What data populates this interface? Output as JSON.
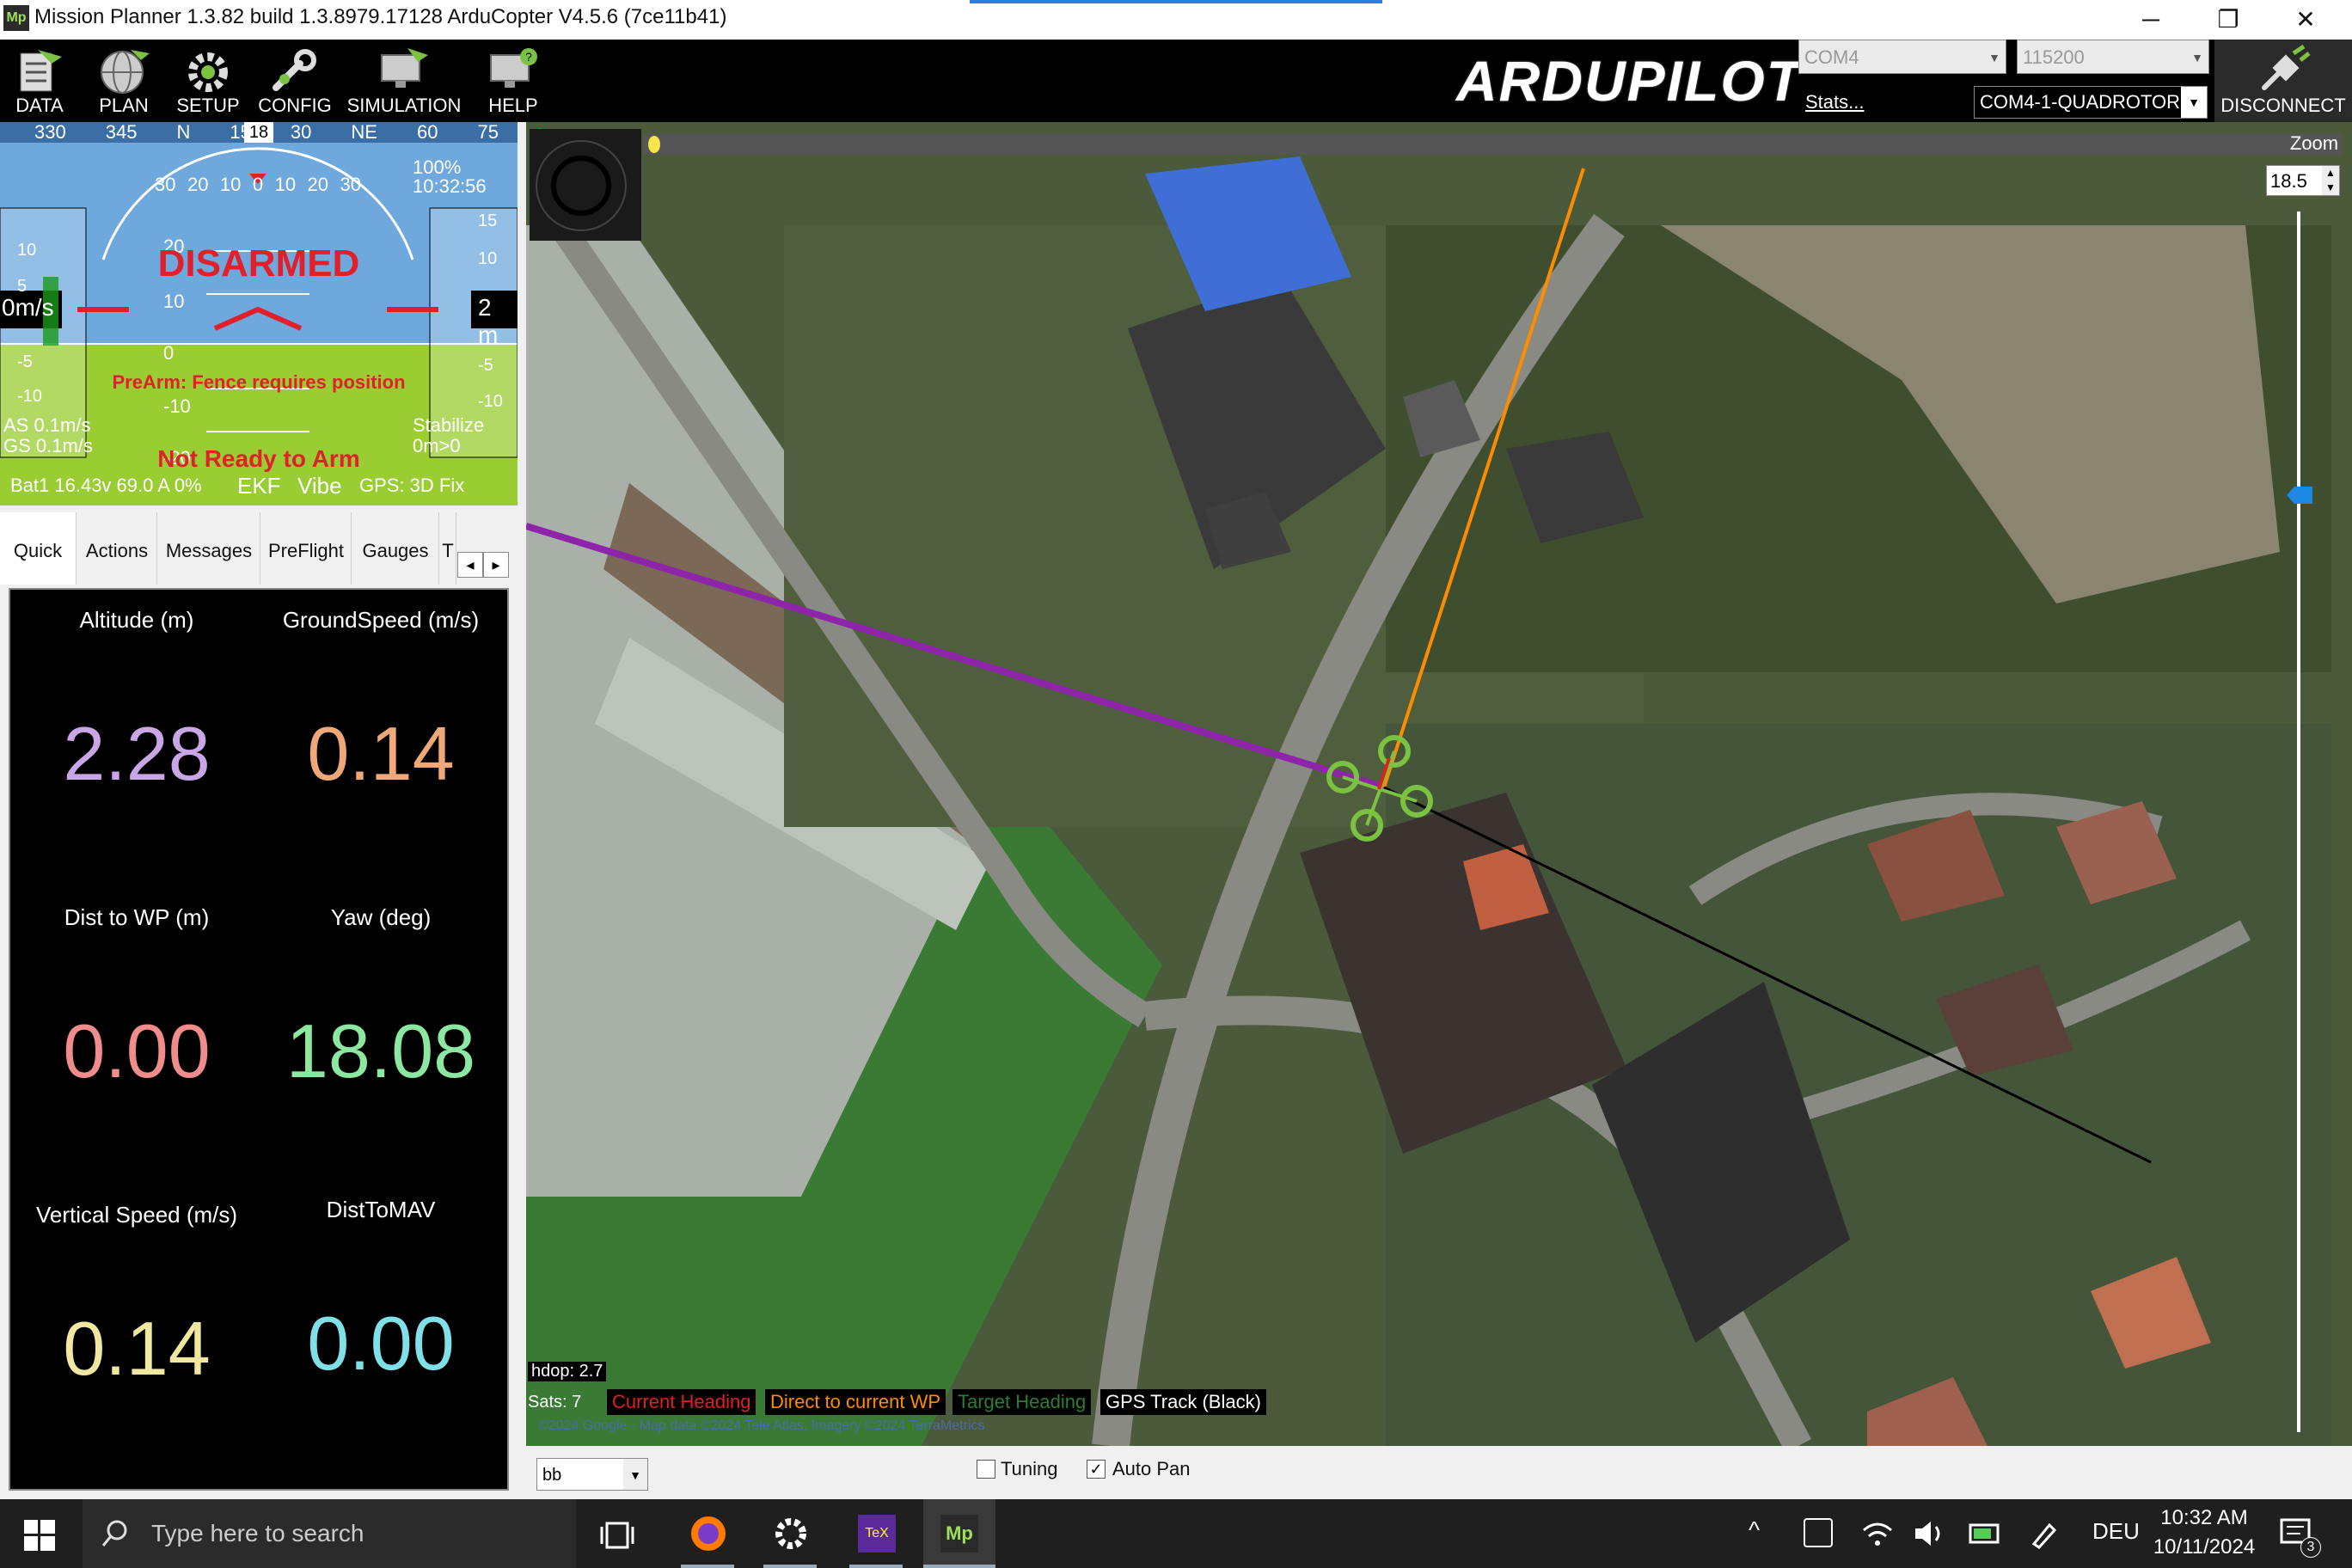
{
  "window": {
    "title": "Mission Planner 1.3.82 build 1.3.8979.17128 ArduCopter V4.5.6 (7ce11b41)",
    "icon_text": "Mp",
    "minimize_glyph": "─",
    "maximize_glyph": "❐",
    "close_glyph": "✕"
  },
  "toolbar": {
    "buttons": [
      {
        "label": "DATA",
        "icon": "data-icon"
      },
      {
        "label": "PLAN",
        "icon": "globe-icon"
      },
      {
        "label": "SETUP",
        "icon": "gear-icon"
      },
      {
        "label": "CONFIG",
        "icon": "wrench-icon"
      },
      {
        "label": "SIMULATION",
        "icon": "monitor-plane-icon"
      },
      {
        "label": "HELP",
        "icon": "monitor-help-icon"
      }
    ],
    "logo": "ARDUPILOT",
    "com_port": "COM4",
    "baud_rate": "115200",
    "stats_link": "Stats...",
    "connection": "COM4-1-QUADROTOR",
    "disconnect_label": "DISCONNECT"
  },
  "hud": {
    "heading_tape": [
      "330",
      "345",
      "N",
      "15",
      "30",
      "NE",
      "60",
      "75"
    ],
    "heading_value": "18",
    "pitch_labels": [
      "30",
      "20",
      "10",
      "0",
      "10",
      "20",
      "30"
    ],
    "status_main": "DISARMED",
    "prearm_message": "PreArm: Fence requires position",
    "not_ready": "Not Ready to Arm",
    "speed_value": "0m/s",
    "alt_value": "2 m",
    "time": "10:32:56",
    "battery_pct": "100%",
    "airspeed": "AS 0.1m/s",
    "groundspeed": "GS 0.1m/s",
    "mode": "Stabilize",
    "wp_info": "0m>0",
    "battery": "Bat1 16.43v 69.0 A 0%",
    "ekf": "EKF",
    "vibe": "Vibe",
    "gps": "GPS: 3D Fix",
    "left_scale": [
      "10",
      "5",
      "-5",
      "-10"
    ],
    "right_scale": [
      "15",
      "10",
      "-5",
      "-10"
    ],
    "pitch_scale": [
      "20",
      "10",
      "0",
      "-10",
      "-20"
    ],
    "colors": {
      "sky": "#6fa8dc",
      "ground": "#9acd32",
      "alert": "#e0202a"
    }
  },
  "tabs": {
    "items": [
      "Quick",
      "Actions",
      "Messages",
      "PreFlight",
      "Gauges",
      "T"
    ],
    "active": "Quick",
    "scroll_left": "◂",
    "scroll_right": "▸"
  },
  "quick": {
    "cells": [
      {
        "label": "Altitude (m)",
        "value": "2.28",
        "color": "#c9a6e6"
      },
      {
        "label": "GroundSpeed (m/s)",
        "value": "0.14",
        "color": "#f0a878"
      },
      {
        "label": "Dist to WP (m)",
        "value": "0.00",
        "color": "#f08c8c"
      },
      {
        "label": "Yaw (deg)",
        "value": "18.08",
        "color": "#8ce8a0"
      },
      {
        "label": "Vertical Speed (m/s)",
        "value": "0.14",
        "color": "#f0e8a0"
      },
      {
        "label": "DistToMAV",
        "value": "0.00",
        "color": "#80e0e8"
      }
    ]
  },
  "map": {
    "marker_zero": "0",
    "zoom_label": "Zoom",
    "zoom_value": "18.5",
    "hdop": "hdop: 2.7",
    "sats": "Sats: 7",
    "legend": [
      {
        "text": "Current Heading",
        "color": "#e02020"
      },
      {
        "text": "Direct to current WP",
        "color": "#ff8c00"
      },
      {
        "text": "Target Heading",
        "color": "#2e7d32"
      },
      {
        "text": "GPS Track (Black)",
        "color": "#ffffff"
      }
    ],
    "copyright": "©2024 Google - Map data ©2024 Tele Atlas, Imagery ©2024 TerraMetrics"
  },
  "bottom_bar": {
    "dropdown_value": "bb",
    "tuning_label": "Tuning",
    "tuning_checked": false,
    "autopan_label": "Auto Pan",
    "autopan_checked": true
  },
  "taskbar": {
    "search_placeholder": "Type here to search",
    "language": "DEU",
    "time": "10:32 AM",
    "date": "10/11/2024",
    "notification_count": "3"
  }
}
